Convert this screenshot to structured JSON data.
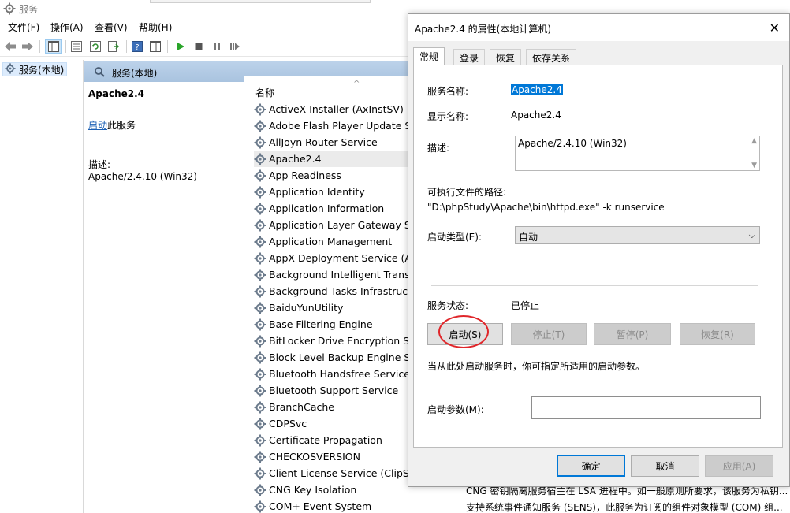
{
  "window": {
    "title": "服务",
    "menu": [
      "文件(F)",
      "操作(A)",
      "查看(V)",
      "帮助(H)"
    ]
  },
  "tree": {
    "root_label": "服务(本地)"
  },
  "content_header": "服务(本地)",
  "detail": {
    "service_name": "Apache2.4",
    "start_link": "启动",
    "start_suffix": "此服务",
    "description_label": "描述:",
    "description_value": "Apache/2.4.10 (Win32)"
  },
  "list": {
    "column_name": "名称",
    "rows": [
      "ActiveX Installer (AxInstSV)",
      "Adobe Flash Player Update Se",
      "AllJoyn Router Service",
      "Apache2.4",
      "App Readiness",
      "Application Identity",
      "Application Information",
      "Application Layer Gateway Ser",
      "Application Management",
      "AppX Deployment Service (Ap",
      "Background Intelligent Transfe",
      "Background Tasks Infrastructu",
      "BaiduYunUtility",
      "Base Filtering Engine",
      "BitLocker Drive Encryption Ser",
      "Block Level Backup Engine Ser",
      "Bluetooth Handsfree Service",
      "Bluetooth Support Service",
      "BranchCache",
      "CDPSvc",
      "Certificate Propagation",
      "CHECKOSVERSION",
      "Client License Service (ClipSVC",
      "CNG Key Isolation",
      "COM+ Event System"
    ],
    "desc_cng": "CNG 密钥隔离服务宿主在 LSA 进程中。如一般原则所要求，该服务为私钥...",
    "desc_com": "支持系统事件通知服务 (SENS)，此服务为订阅的组件对象模型 (COM) 组..."
  },
  "dialog": {
    "title": "Apache2.4 的属性(本地计算机)",
    "tabs": [
      "常规",
      "登录",
      "恢复",
      "依存关系"
    ],
    "service_name_label": "服务名称:",
    "service_name_value": "Apache2.4",
    "display_name_label": "显示名称:",
    "display_name_value": "Apache2.4",
    "description_label": "描述:",
    "description_value": "Apache/2.4.10 (Win32)",
    "exe_path_label": "可执行文件的路径:",
    "exe_path_value": "\"D:\\phpStudy\\Apache\\bin\\httpd.exe\" -k runservice",
    "startup_type_label": "启动类型(E):",
    "startup_type_value": "自动",
    "status_label": "服务状态:",
    "status_value": "已停止",
    "btn_start": "启动(S)",
    "btn_stop": "停止(T)",
    "btn_pause": "暂停(P)",
    "btn_resume": "恢复(R)",
    "hint": "当从此处启动服务时，你可指定所适用的启动参数。",
    "params_label": "启动参数(M):",
    "btn_ok": "确定",
    "btn_cancel": "取消",
    "btn_apply": "应用(A)"
  },
  "colors": {
    "selection": "#0078d7",
    "header_bg": "#bcd2ea",
    "annotation_circle": "#e0262a"
  }
}
